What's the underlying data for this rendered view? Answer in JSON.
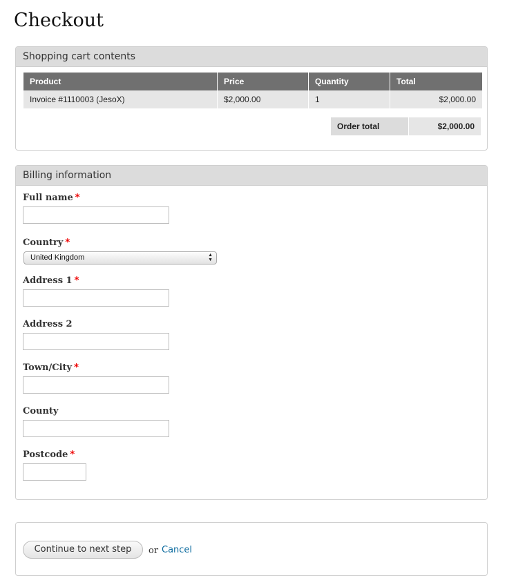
{
  "page": {
    "title": "Checkout"
  },
  "cart": {
    "title": "Shopping cart contents",
    "columns": [
      "Product",
      "Price",
      "Quantity",
      "Total"
    ],
    "rows": [
      {
        "product": "Invoice #1110003 (JesoX)",
        "price": "$2,000.00",
        "quantity": "1",
        "total": "$2,000.00"
      }
    ],
    "order_total_label": "Order total",
    "order_total_value": "$2,000.00"
  },
  "billing": {
    "title": "Billing information",
    "full_name": {
      "label": "Full name",
      "value": ""
    },
    "country": {
      "label": "Country",
      "selected": "United Kingdom"
    },
    "address1": {
      "label": "Address 1",
      "value": ""
    },
    "address2": {
      "label": "Address 2",
      "value": ""
    },
    "town": {
      "label": "Town/City",
      "value": ""
    },
    "county": {
      "label": "County",
      "value": ""
    },
    "postcode": {
      "label": "Postcode",
      "value": ""
    },
    "required_marker": "*"
  },
  "actions": {
    "continue_label": "Continue to next step",
    "or_text": "or",
    "cancel_label": "Cancel"
  },
  "colors": {
    "link": "#0b6a9e",
    "required": "#ee0000",
    "table_header": "#707070"
  }
}
